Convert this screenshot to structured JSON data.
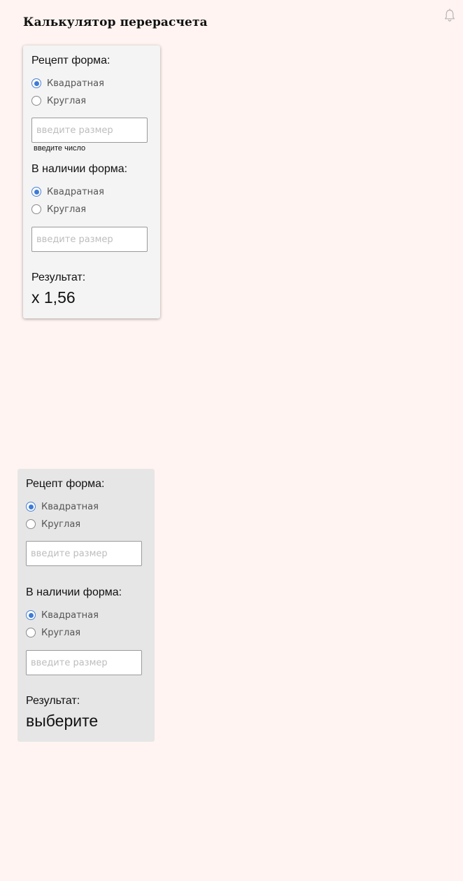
{
  "page": {
    "title": "Калькулятор перерасчета"
  },
  "calculators": [
    {
      "recipe_label": "Рецепт форма:",
      "recipe_options": [
        "Квадратная",
        "Круглая"
      ],
      "recipe_selected": "Квадратная",
      "recipe_placeholder": "введите размер",
      "recipe_hint": "введите число",
      "available_label": "В наличии форма:",
      "available_options": [
        "Квадратная",
        "Круглая"
      ],
      "available_selected": "Квадратная",
      "available_placeholder": "введите размер",
      "result_label": "Результат:",
      "result_value": "x 1,56"
    },
    {
      "recipe_label": "Рецепт форма:",
      "recipe_options": [
        "Квадратная",
        "Круглая"
      ],
      "recipe_selected": "Квадратная",
      "recipe_placeholder": "введите размер",
      "available_label": "В наличии форма:",
      "available_options": [
        "Квадратная",
        "Круглая"
      ],
      "available_selected": "Квадратная",
      "available_placeholder": "введите размер",
      "result_label": "Результат:",
      "result_value": "выберите"
    }
  ],
  "icons": {
    "notifications": "bell-icon"
  },
  "colors": {
    "background": "#fff4f1",
    "card_primary": "#f4f4f4",
    "card_secondary": "#e6e6e6",
    "radio_accent": "#3d7bd6"
  }
}
